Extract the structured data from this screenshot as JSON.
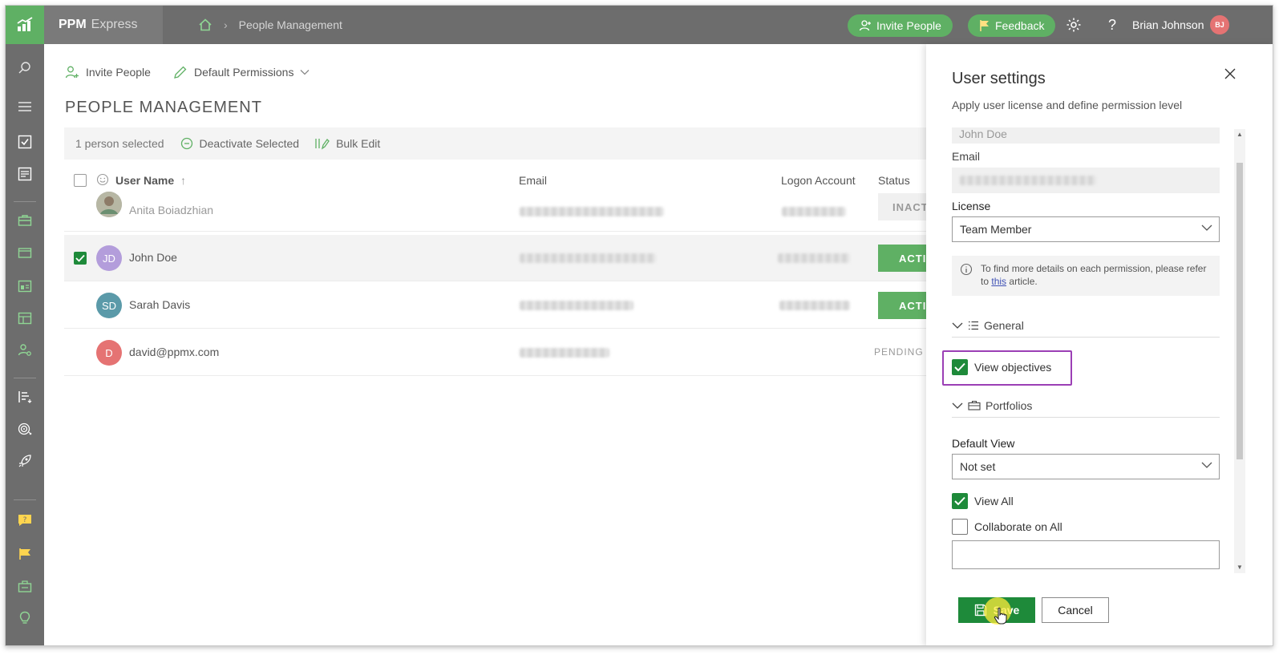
{
  "app": {
    "brand_primary": "PPM",
    "brand_secondary": "Express",
    "accent_color": "#5fb064",
    "topbar_color": "#6d6d6d"
  },
  "breadcrumb": {
    "current": "People Management"
  },
  "topbar": {
    "invite_label": "Invite People",
    "feedback_label": "Feedback",
    "user_name": "Brian Johnson",
    "user_initials": "BJ"
  },
  "leftnav": {
    "icons": [
      "search-icon",
      "menu-icon",
      "tasks-icon",
      "reports-icon",
      "portfolio-icon",
      "projects-icon",
      "dashboard-icon",
      "resources-icon",
      "people-icon",
      "roadmap-icon",
      "objectives-icon",
      "launch-icon",
      "help-icon",
      "feedback-icon",
      "integrations-icon",
      "ideas-icon"
    ]
  },
  "main": {
    "toolbar": {
      "invite_label": "Invite People",
      "default_permissions_label": "Default Permissions"
    },
    "page_title": "PEOPLE MANAGEMENT",
    "selection": {
      "count_label": "1 person selected",
      "deactivate_label": "Deactivate Selected",
      "bulk_edit_label": "Bulk Edit"
    },
    "columns": {
      "user_name": "User Name",
      "email": "Email",
      "logon": "Logon Account",
      "status": "Status"
    },
    "rows": [
      {
        "initials": "",
        "name": "Anita Boiadzhian",
        "status": "INACT",
        "color": "#a9a9a9"
      },
      {
        "initials": "JD",
        "name": "John Doe",
        "status": "ACTIV",
        "color": "#b39ddb",
        "selected": true
      },
      {
        "initials": "SD",
        "name": "Sarah Davis",
        "status": "ACTIV",
        "color": "#5b9aa9"
      },
      {
        "initials": "D",
        "name": "david@ppmx.com",
        "status": "PENDING",
        "color": "#e57373"
      }
    ]
  },
  "panel": {
    "title": "User settings",
    "subtitle": "Apply user license and define permission level",
    "name_value": "John Doe",
    "email_label": "Email",
    "license_label": "License",
    "license_value": "Team Member",
    "info_text_before": "To find more details on each permission, please refer to",
    "info_link": "this",
    "info_text_after": "article.",
    "general_label": "General",
    "view_objectives_label": "View objectives",
    "portfolios_label": "Portfolios",
    "default_view_label": "Default View",
    "default_view_value": "Not set",
    "view_all_label": "View All",
    "collaborate_label": "Collaborate on All",
    "save_label": "Save",
    "cancel_label": "Cancel",
    "highlight_color": "#9b3fb5",
    "checkbox_color": "#1e8a3a"
  }
}
